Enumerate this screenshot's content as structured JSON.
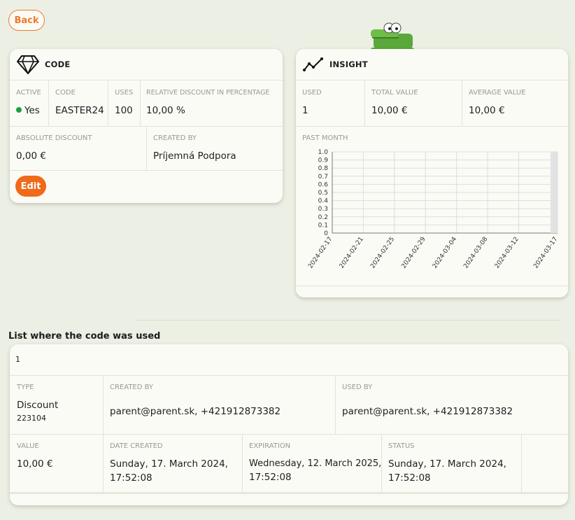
{
  "back_label": "Back",
  "code_card": {
    "title": "CODE",
    "active_label": "ACTIVE",
    "active_value": "Yes",
    "code_label": "CODE",
    "code_value": "EASTER24",
    "uses_label": "USES",
    "uses_value": "100",
    "relative_label": "RELATIVE DISCOUNT IN PERCENTAGE",
    "relative_value": "10,00 %",
    "absolute_label": "ABSOLUTE DISCOUNT",
    "absolute_value": "0,00 €",
    "created_by_label": "CREATED BY",
    "created_by_value": "Príjemná Podpora",
    "edit_label": "Edit"
  },
  "insight_card": {
    "title": "INSIGHT",
    "used_label": "USED",
    "used_value": "1",
    "total_label": "TOTAL VALUE",
    "total_value": "10,00 €",
    "average_label": "AVERAGE VALUE",
    "average_value": "10,00 €",
    "past_month_label": "PAST MONTH"
  },
  "chart_data": {
    "type": "bar",
    "y_ticks": [
      "0",
      "0.1",
      "0.2",
      "0.3",
      "0.4",
      "0.5",
      "0.6",
      "0.7",
      "0.8",
      "0.9",
      "1.0"
    ],
    "ylim": [
      0,
      1.0
    ],
    "x_ticks": [
      "2024-02-17",
      "2024-02-21",
      "2024-02-25",
      "2024-02-29",
      "2024-03-04",
      "2024-03-08",
      "2024-03-12",
      "2024-03-17"
    ],
    "x_range": [
      "2024-02-17",
      "2024-03-17"
    ],
    "values": [
      {
        "x": "2024-03-17",
        "y": 1
      }
    ],
    "grid": true
  },
  "list": {
    "title": "List where the code was used",
    "count": "1",
    "type_label": "TYPE",
    "type_value": "Discount",
    "type_id": "223104",
    "created_by_label": "CREATED BY",
    "created_by_value": "parent@parent.sk, +421912873382",
    "used_by_label": "USED BY",
    "used_by_value": "parent@parent.sk, +421912873382",
    "value_label": "VALUE",
    "value_value": "10,00 €",
    "date_created_label": "DATE CREATED",
    "date_created_line1": "Sunday, 17. March 2024,",
    "date_created_line2": "17:52:08",
    "expiration_label": "EXPIRATION",
    "expiration_line1": "Wednesday, 12. March 2025,",
    "expiration_line2": "17:52:08",
    "status_label": "STATUS",
    "status_line1": "Sunday, 17. March 2024,",
    "status_line2": "17:52:08"
  },
  "icons": {
    "code": "diamond-icon",
    "insight": "trend-line-icon",
    "mascot": "crocodile-mascot"
  },
  "colors": {
    "accent": "#f06a1a",
    "background": "#ecefe3",
    "active_dot": "#1e9f3c"
  }
}
